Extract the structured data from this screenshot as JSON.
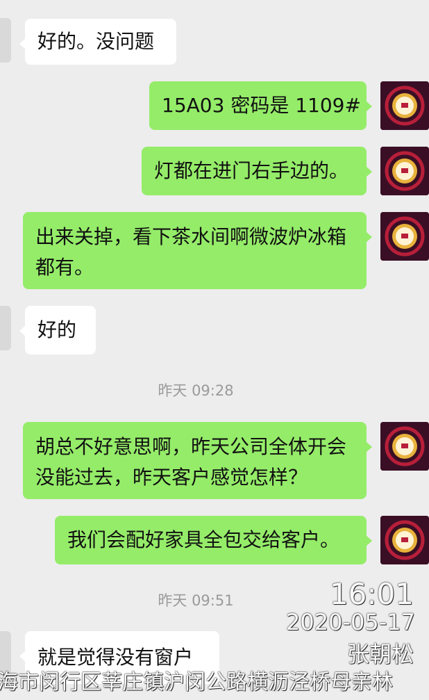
{
  "messages": [
    {
      "side": "in",
      "text": "好的。没问题"
    },
    {
      "side": "out",
      "text": "15A03 密码是 1109#"
    },
    {
      "side": "out",
      "text": "灯都在进门右手边的。"
    },
    {
      "side": "out",
      "text": "出来关掉，看下茶水间啊微波炉冰箱都有。"
    },
    {
      "side": "in",
      "text": "好的"
    },
    {
      "side": "out",
      "text": "胡总不好意思啊，昨天公司全体开会没能过去，昨天客户感觉怎样？"
    },
    {
      "side": "out",
      "text": "我们会配好家具全包交给客户。"
    },
    {
      "side": "in",
      "text": "就是觉得没有窗户"
    }
  ],
  "timestamps": [
    "昨天 09:28",
    "昨天 09:51"
  ],
  "watermark": {
    "time": "16:01",
    "date": "2020-05-17",
    "name": "张朝松",
    "address": "海市闵行区莘庄镇沪闵公路横沥泾桥母亲林"
  },
  "avatar": {
    "icon": "festive-lantern-avatar-icon",
    "colors": [
      "#3a0f25",
      "#b81f3a",
      "#e8b23c"
    ]
  }
}
